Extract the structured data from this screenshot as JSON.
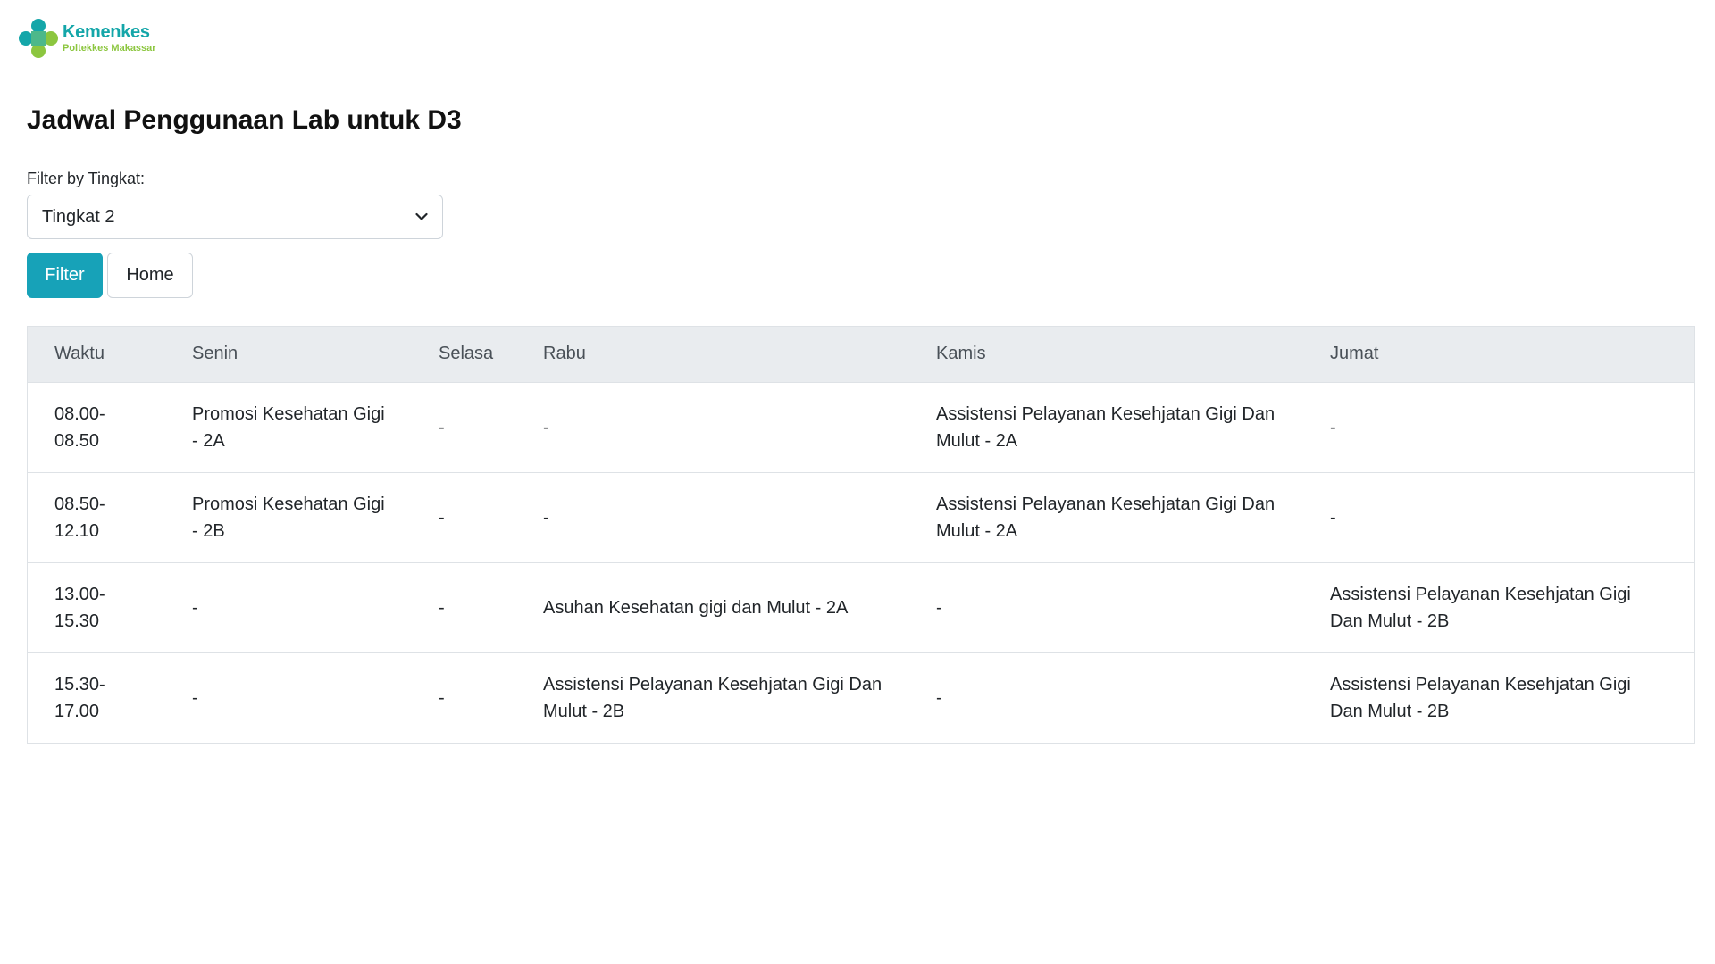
{
  "brand": {
    "name": "Kemenkes",
    "subtitle": "Poltekkes Makassar",
    "colors": {
      "teal": "#14a6a9",
      "green": "#8cc63f"
    }
  },
  "page": {
    "title": "Jadwal Penggunaan Lab untuk D3"
  },
  "filter": {
    "label": "Filter by Tingkat:",
    "selected": "Tingkat 2",
    "filter_button": "Filter",
    "home_button": "Home",
    "accent_color": "#17a2b8"
  },
  "table": {
    "headers": [
      "Waktu",
      "Senin",
      "Selasa",
      "Rabu",
      "Kamis",
      "Jumat"
    ],
    "rows": [
      [
        "08.00-08.50",
        "Promosi Kesehatan Gigi - 2A",
        "-",
        "-",
        "Assistensi Pelayanan Kesehjatan Gigi Dan Mulut - 2A",
        "-"
      ],
      [
        "08.50-12.10",
        "Promosi Kesehatan Gigi - 2B",
        "-",
        "-",
        "Assistensi Pelayanan Kesehjatan Gigi Dan Mulut - 2A",
        "-"
      ],
      [
        "13.00-15.30",
        "-",
        "-",
        "Asuhan Kesehatan gigi dan Mulut - 2A",
        "-",
        "Assistensi Pelayanan Kesehjatan Gigi Dan Mulut - 2B"
      ],
      [
        "15.30-17.00",
        "-",
        "-",
        "Assistensi Pelayanan Kesehjatan Gigi Dan Mulut - 2B",
        "-",
        "Assistensi Pelayanan Kesehjatan Gigi Dan Mulut - 2B"
      ]
    ]
  }
}
